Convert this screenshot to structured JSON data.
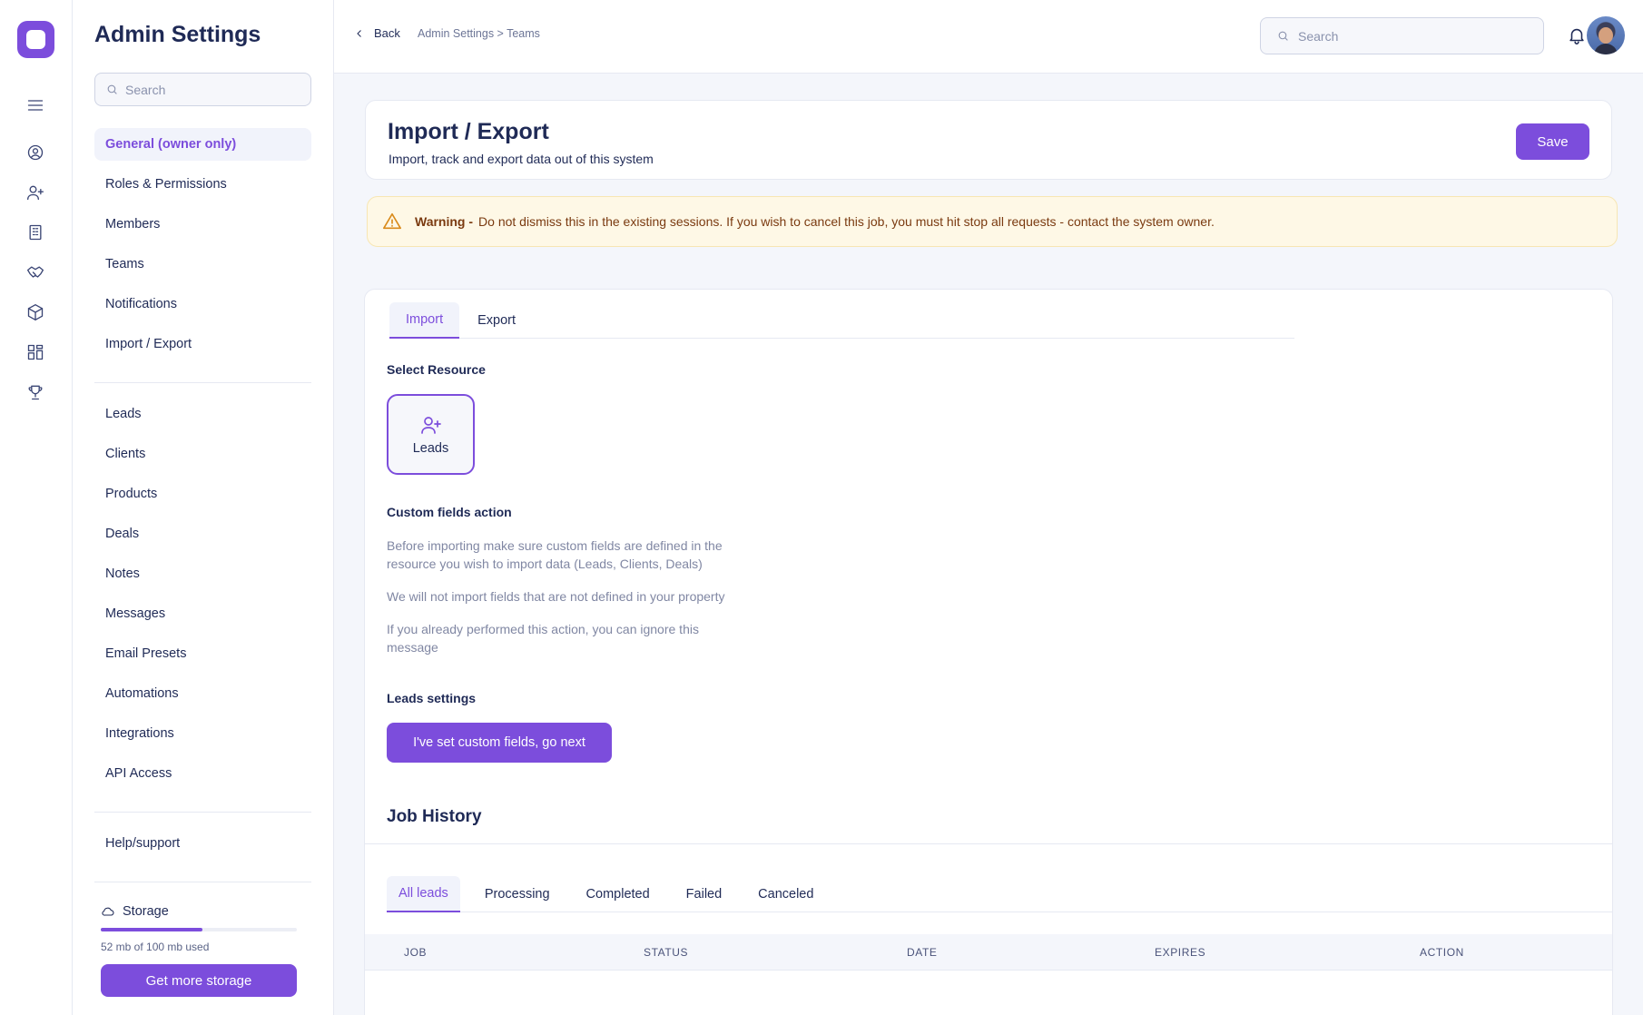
{
  "rail": {
    "icons": [
      "menu-icon",
      "user-circle-icon",
      "user-plus-icon",
      "building-icon",
      "handshake-icon",
      "box-icon",
      "grid-icon",
      "trophy-icon"
    ]
  },
  "sidebar": {
    "title": "Admin Settings",
    "search_placeholder": "Search",
    "group1": [
      {
        "label": "General (owner only)",
        "active": true
      },
      {
        "label": "Roles & Permissions"
      },
      {
        "label": "Members"
      },
      {
        "label": "Teams"
      },
      {
        "label": "Notifications"
      },
      {
        "label": "Import / Export"
      }
    ],
    "group2": [
      {
        "label": "Leads"
      },
      {
        "label": "Clients"
      },
      {
        "label": "Products"
      },
      {
        "label": "Deals"
      },
      {
        "label": "Notes"
      },
      {
        "label": "Messages"
      },
      {
        "label": "Email Presets"
      },
      {
        "label": "Automations"
      },
      {
        "label": "Integrations"
      },
      {
        "label": "API Access"
      }
    ],
    "help": "Help/support",
    "storage": {
      "label": "Storage",
      "used_text": "52 mb of 100 mb used",
      "used_fraction": 0.52,
      "button": "Get more storage"
    }
  },
  "topbar": {
    "back_label": "Back",
    "breadcrumb": "Admin Settings > Teams",
    "search_placeholder": "Search"
  },
  "header": {
    "title": "Import / Export",
    "subtitle": "Import, track and export data out of this system",
    "save_label": "Save"
  },
  "warning": {
    "strong": "Warning -",
    "text": "Do not dismiss this in the existing sessions. If you wish to cancel this job, you must hit stop all requests - contact the system owner."
  },
  "main": {
    "tabs": [
      {
        "label": "Import",
        "active": true
      },
      {
        "label": "Export"
      }
    ],
    "select_resource_label": "Select Resource",
    "resource": {
      "label": "Leads",
      "icon": "user-plus-icon"
    },
    "custom_fields_label": "Custom fields action",
    "paragraphs": [
      "Before importing make sure custom fields are defined in the resource you wish to import data (Leads, Clients, Deals)",
      "We will not import fields that are not defined in your property",
      "If you already performed this action, you can ignore this message"
    ],
    "leads_settings_label": "Leads settings",
    "next_button": "I've set custom fields, go next"
  },
  "job_history": {
    "title": "Job History",
    "tabs": [
      {
        "label": "All leads",
        "active": true
      },
      {
        "label": "Processing"
      },
      {
        "label": "Completed"
      },
      {
        "label": "Failed"
      },
      {
        "label": "Canceled"
      }
    ],
    "columns": [
      "JOB",
      "STATUS",
      "DATE",
      "EXPIRES",
      "ACTION"
    ]
  },
  "colors": {
    "accent": "#7c4ddc",
    "text": "#1f2a56",
    "warning_bg": "#fef8e6",
    "warning_text": "#7a3a10"
  }
}
